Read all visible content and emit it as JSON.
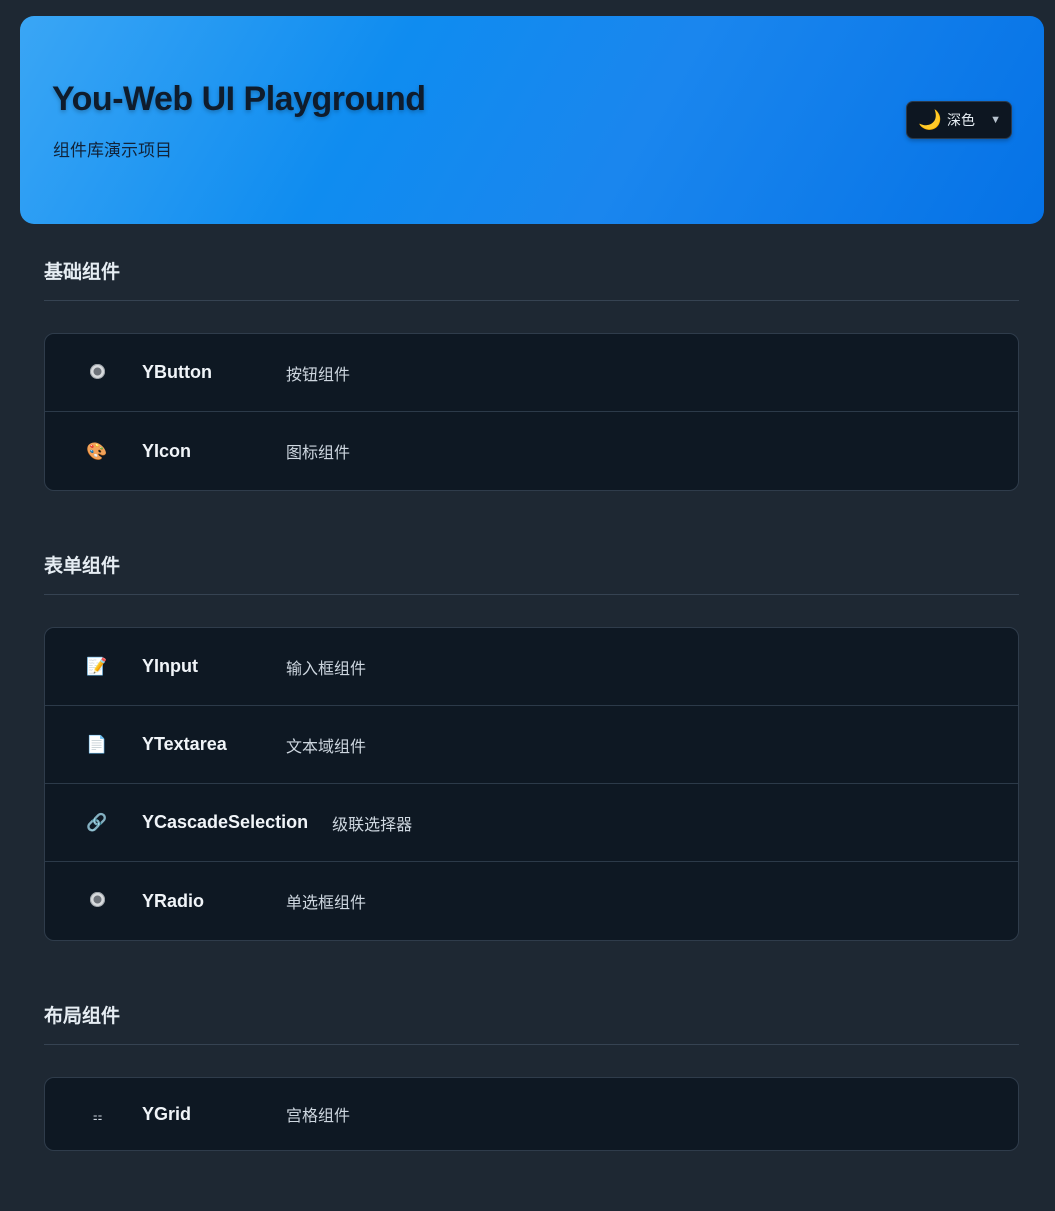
{
  "header": {
    "title": "You-Web UI Playground",
    "subtitle": "组件库演示项目",
    "theme_select": {
      "icon": "moon-icon",
      "icon_glyph": "🌙",
      "selected": "深色",
      "caret": "▼"
    }
  },
  "sections": [
    {
      "title": "基础组件",
      "items": [
        {
          "icon": "radio-icon",
          "glyph": "",
          "name": "YButton",
          "desc": "按钮组件"
        },
        {
          "icon": "palette-icon",
          "glyph": "🎨",
          "name": "YIcon",
          "desc": "图标组件"
        }
      ]
    },
    {
      "title": "表单组件",
      "items": [
        {
          "icon": "memo-icon",
          "glyph": "📝",
          "name": "YInput",
          "desc": "输入框组件"
        },
        {
          "icon": "document-icon",
          "glyph": "📄",
          "name": "YTextarea",
          "desc": "文本域组件"
        },
        {
          "icon": "link-icon",
          "glyph": "🔗",
          "name": "YCascadeSelection",
          "desc": "级联选择器"
        },
        {
          "icon": "radio-icon",
          "glyph": "",
          "name": "YRadio",
          "desc": "单选框组件"
        }
      ]
    },
    {
      "title": "布局组件",
      "items": [
        {
          "icon": "grid-icon",
          "glyph": "⚏",
          "name": "YGrid",
          "desc": "宫格组件"
        }
      ]
    }
  ],
  "colors": {
    "page_bg": "#1e2833",
    "header_gradient_start": "#3aa6f5",
    "header_gradient_end": "#0572e6",
    "card_bg": "#0e1823",
    "text_primary": "#f0f4f8"
  }
}
